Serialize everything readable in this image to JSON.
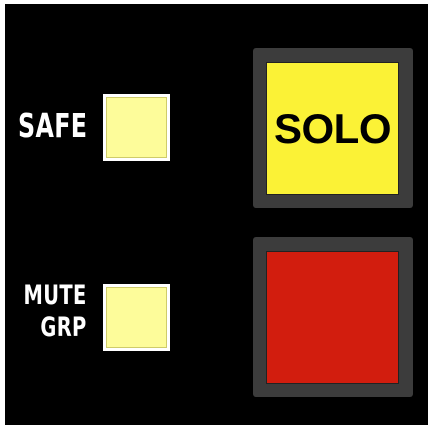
{
  "labels": {
    "safe": "SAFE",
    "mute_line1": "MUTE",
    "mute_line2": "GRP"
  },
  "buttons": {
    "solo_label": "SOLO",
    "red_label": ""
  },
  "colors": {
    "panel_background": "#000000",
    "small_button": "#fdfc9a",
    "solo_button": "#fbf236",
    "red_button": "#d21d0e",
    "bezel": "#3c3c3c"
  }
}
